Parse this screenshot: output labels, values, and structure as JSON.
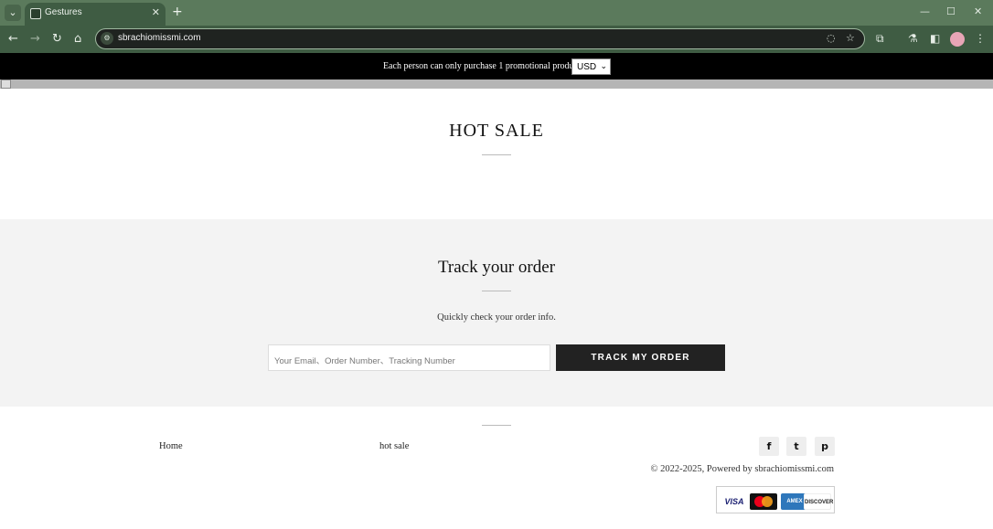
{
  "browser": {
    "tab_title": "Gestures",
    "url": "sbrachiomissmi.com",
    "icons": {
      "tab_list": "chevron-down-icon",
      "new_tab": "plus-icon",
      "back": "arrow-left-icon",
      "forward": "arrow-right-icon",
      "reload": "reload-icon",
      "home": "home-icon",
      "site_info": "site-info-icon",
      "eye_off": "eye-off-icon",
      "bookmark": "star-icon",
      "extensions": "puzzle-icon",
      "labs": "flask-icon",
      "side_panel": "side-panel-icon",
      "menu": "kebab-menu-icon"
    }
  },
  "announcement": {
    "text": "Each person can only purchase 1 promotional products",
    "currency": "USD"
  },
  "hot_sale": {
    "title": "HOT SALE"
  },
  "track": {
    "title": "Track your order",
    "subtitle": "Quickly check your order info.",
    "input_placeholder": "Your Email、Order Number、Tracking Number",
    "button_label": "TRACK MY ORDER"
  },
  "footer": {
    "links": [
      "Home",
      "hot sale"
    ],
    "social": [
      "facebook-icon",
      "twitter-icon",
      "pinterest-icon"
    ],
    "copyright": "© 2022-2025, Powered by sbrachiomissmi.com",
    "payments": [
      "VISA",
      "MasterCard",
      "AMEX",
      "DISCOVER"
    ]
  },
  "colors": {
    "chrome_tabbar": "#5b7a5c",
    "chrome_toolbar": "#3f5c43",
    "announcement_bg": "#000000",
    "track_section_bg": "#f3f3f3",
    "track_button_bg": "#222222"
  }
}
